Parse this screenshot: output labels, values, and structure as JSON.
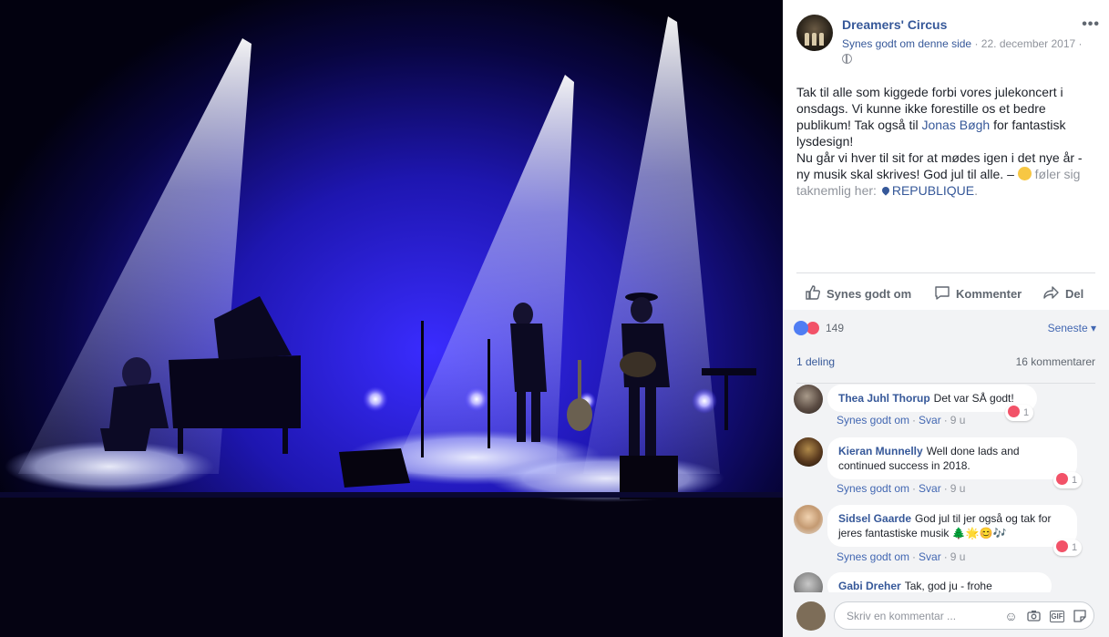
{
  "post": {
    "page_name": "Dreamers' Circus",
    "like_page": "Synes godt om denne side",
    "separator": "·",
    "date": "22. december 2017",
    "text": {
      "part1": "Tak til alle som kiggede forbi vores julekoncert i onsdags. Vi kunne ikke forestille os et bedre publikum! Tak også til ",
      "mention": "Jonas Bøgh",
      "part2": " for fantastisk lysdesign!",
      "part3": "Nu går vi hver til sit for at mødes igen i det nye år - ny musik skal skrives! God jul til alle. –",
      "feeling": "føler sig taknemlig her:",
      "location": "REPUBLIQUE",
      "period": "."
    }
  },
  "actions": {
    "like": "Synes godt om",
    "comment": "Kommenter",
    "share": "Del"
  },
  "stats": {
    "reactions": "149",
    "sort": "Seneste",
    "shares": "1 deling",
    "comments": "16 kommentarer"
  },
  "comments": [
    {
      "author": "Thea Juhl Thorup",
      "text": "Det var SÅ godt!",
      "like": "Synes godt om",
      "reply": "Svar",
      "time": "9 u",
      "reactions": "1"
    },
    {
      "author": "Kieran Munnelly",
      "text": "Well done lads and continued success in 2018.",
      "like": "Synes godt om",
      "reply": "Svar",
      "time": "9 u",
      "reactions": "1"
    },
    {
      "author": "Sidsel Gaarde",
      "text": "God jul til jer også og tak for jeres fantastiske musik",
      "emojis": "🌲🌟😊🎶",
      "like": "Synes godt om",
      "reply": "Svar",
      "time": "9 u",
      "reactions": "1"
    },
    {
      "author": "Gabi Dreher",
      "text": "Tak, god ju - frohe"
    }
  ],
  "composer": {
    "placeholder": "Skriv en kommentar ..."
  },
  "icons": {
    "more": "more-options-icon",
    "globe": "globe-icon",
    "like": "thumbs-up-icon",
    "comment": "speech-bubble-icon",
    "share": "share-arrow-icon",
    "emoji": "smiley-icon",
    "camera": "camera-icon",
    "gif": "gif-icon",
    "sticker": "sticker-icon"
  },
  "colors": {
    "link": "#365899",
    "muted": "#90949c",
    "stage_blue": "#2a22d8",
    "like_blue": "#4f7df3",
    "love_red": "#f25268"
  }
}
